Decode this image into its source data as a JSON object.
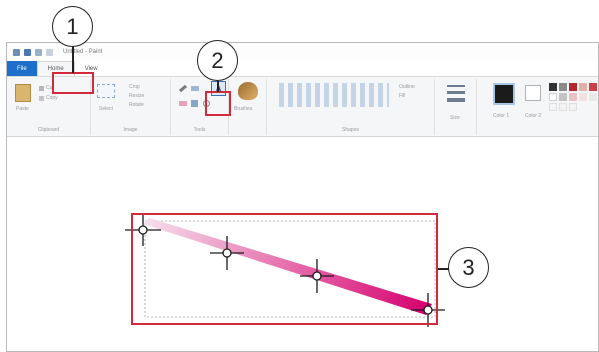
{
  "window": {
    "title": "Untitled - Paint"
  },
  "tabs": {
    "file": "File",
    "home": "Home",
    "view": "View"
  },
  "ribbon": {
    "clipboard": {
      "paste": "Paste",
      "cut": "Cut",
      "copy": "Copy",
      "label": "Clipboard"
    },
    "image": {
      "select": "Select",
      "crop": "Crop",
      "resize": "Resize",
      "rotate": "Rotate",
      "label": "Image"
    },
    "tools": {
      "label": "Tools",
      "text_tool_glyph": "A"
    },
    "brushes": "Brushes",
    "shapes": {
      "outline": "Outline",
      "fill": "Fill",
      "label": "Shapes"
    },
    "size": "Size",
    "color1": "Color 1",
    "color2": "Color 2"
  },
  "callouts": {
    "one": "1",
    "two": "2",
    "three": "3"
  },
  "colors": {
    "file_tab": "#1e6fc9",
    "callout_red": "#d12a3a",
    "gradient_start": "#f6dfec",
    "gradient_end": "#d6006f"
  }
}
